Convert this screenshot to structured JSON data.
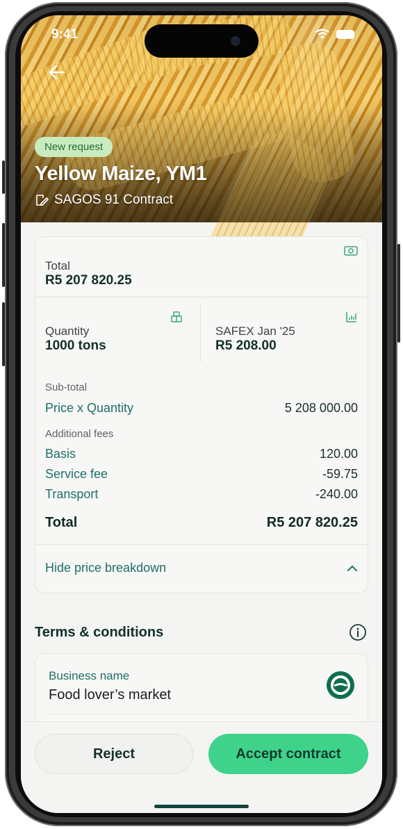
{
  "status_bar": {
    "time": "9:41"
  },
  "hero": {
    "badge": "New request",
    "title": "Yellow Maize, YM1",
    "subtitle": "SAGOS 91 Contract"
  },
  "summary": {
    "total_label": "Total",
    "total_value": "R5 207 820.25",
    "quantity_label": "Quantity",
    "quantity_value": "1000 tons",
    "safex_label": "SAFEX Jan '25",
    "safex_value": "R5 208.00"
  },
  "breakdown": {
    "subtotal_label": "Sub-total",
    "rows": [
      {
        "key": "Price x Quantity",
        "value": "5 208 000.00"
      }
    ],
    "fees_label": "Additional fees",
    "fees": [
      {
        "key": "Basis",
        "value": "120.00"
      },
      {
        "key": "Service fee",
        "value": "-59.75"
      },
      {
        "key": "Transport",
        "value": "-240.00"
      }
    ],
    "total_key": "Total",
    "total_value": "R5 207 820.25",
    "toggle_label": "Hide price breakdown"
  },
  "terms": {
    "title": "Terms & conditions",
    "business_label": "Business name",
    "business_name": "Food lover’s market"
  },
  "actions": {
    "reject": "Reject",
    "accept": "Accept contract"
  },
  "colors": {
    "accent": "#3fd28b",
    "teal_text": "#1f6f68",
    "dark_text": "#12302c",
    "badge_bg": "#c9ecbe"
  },
  "icons": [
    "back-arrow-icon",
    "contract-pen-icon",
    "money-icon",
    "crate-icon",
    "chart-icon",
    "chevron-up-icon",
    "info-icon",
    "business-logo-icon",
    "wifi-icon",
    "battery-icon"
  ]
}
